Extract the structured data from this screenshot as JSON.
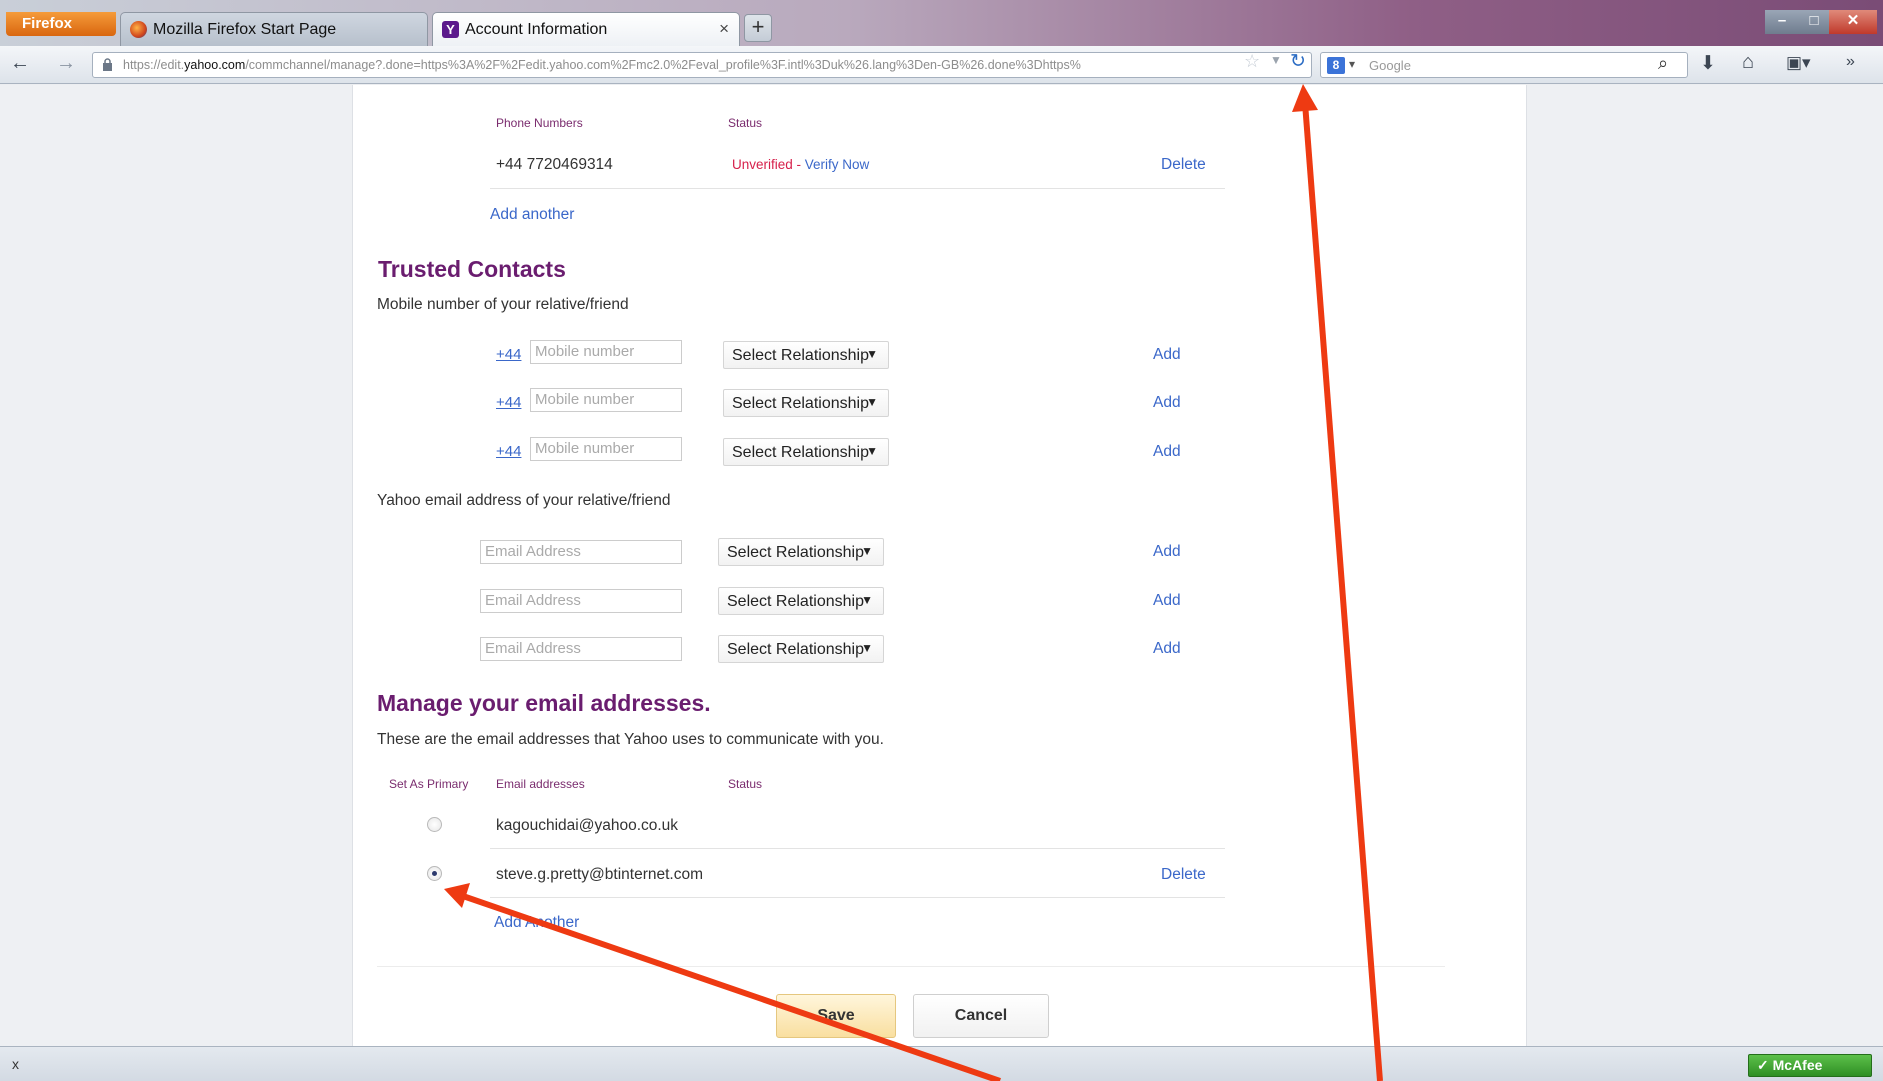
{
  "browser": {
    "app_button": "Firefox",
    "tabs": [
      {
        "title": "Mozilla Firefox Start Page"
      },
      {
        "title": "Account Information"
      }
    ],
    "url_prefix": "https://edit.",
    "url_host": "yahoo.com",
    "url_rest": "/commchannel/manage?.done=https%3A%2F%2Fedit.yahoo.com%2Fmc2.0%2Feval_profile%3F.intl%3Duk%26.lang%3Den-GB%26.done%3Dhttps%",
    "search_placeholder": "Google"
  },
  "phones": {
    "col_phone": "Phone Numbers",
    "col_status": "Status",
    "rows": [
      {
        "number": "+44 7720469314",
        "status_unverified": "Unverified",
        "status_sep": " - ",
        "verify_link": "Verify Now",
        "delete": "Delete"
      }
    ],
    "add_another": "Add another"
  },
  "trusted": {
    "title": "Trusted Contacts",
    "mobile_caption": "Mobile number of your relative/friend",
    "mobile_rows": [
      {
        "country_code": "+44",
        "placeholder": "Mobile number",
        "relationship": "Select Relationship",
        "add": "Add"
      },
      {
        "country_code": "+44",
        "placeholder": "Mobile number",
        "relationship": "Select Relationship",
        "add": "Add"
      },
      {
        "country_code": "+44",
        "placeholder": "Mobile number",
        "relationship": "Select Relationship",
        "add": "Add"
      }
    ],
    "email_caption": "Yahoo email address of your relative/friend",
    "email_rows": [
      {
        "placeholder": "Email Address",
        "relationship": "Select Relationship",
        "add": "Add"
      },
      {
        "placeholder": "Email Address",
        "relationship": "Select Relationship",
        "add": "Add"
      },
      {
        "placeholder": "Email Address",
        "relationship": "Select Relationship",
        "add": "Add"
      }
    ]
  },
  "emails": {
    "title": "Manage your email addresses.",
    "caption": "These are the email addresses that Yahoo uses to communicate with you.",
    "col_primary": "Set As Primary",
    "col_address": "Email addresses",
    "col_status": "Status",
    "rows": [
      {
        "address": "kagouchidai@yahoo.co.uk",
        "primary": false,
        "delete": ""
      },
      {
        "address": "steve.g.pretty@btinternet.com",
        "primary": true,
        "delete": "Delete"
      }
    ],
    "add_another": "Add Another"
  },
  "actions": {
    "save": "Save",
    "cancel": "Cancel"
  },
  "statusbar": {
    "close": "x",
    "mcafee": "McAfee"
  },
  "icons": [
    "back-icon",
    "forward-icon",
    "lock-icon",
    "bookmark-star-icon",
    "reload-icon",
    "search-icon",
    "downloads-icon",
    "home-icon",
    "addons-icon",
    "overflow-icon"
  ],
  "colors": {
    "section_title": "#6a1d6f",
    "link": "#3a67c9",
    "unverified": "#d6204b",
    "annotation_arrow": "#ee3a12"
  }
}
